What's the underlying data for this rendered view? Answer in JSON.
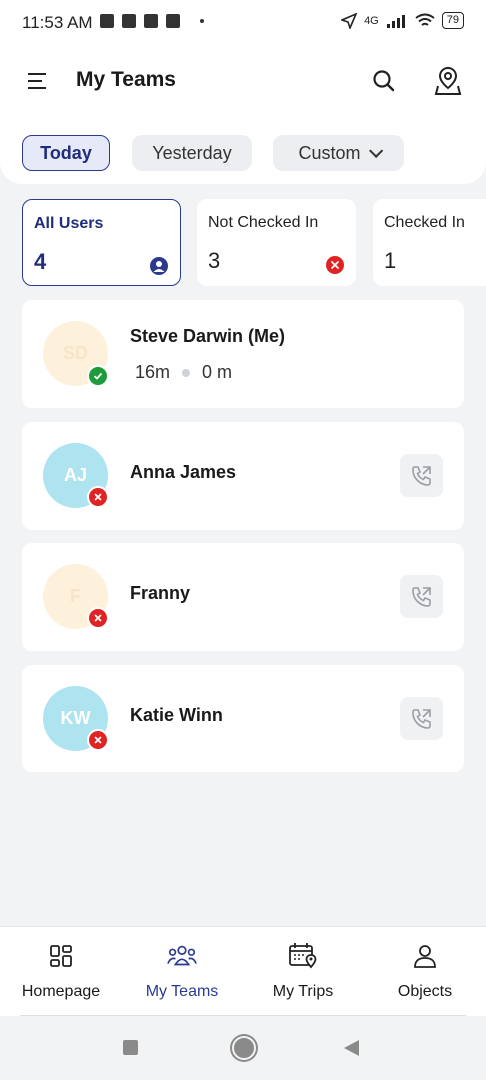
{
  "status_bar": {
    "time": "11:53 AM",
    "network": "4G",
    "battery": "79"
  },
  "header": {
    "title": "My Teams",
    "menu_icon": "hamburger-menu-icon",
    "search_icon": "search-icon",
    "map_icon": "map-pin-icon"
  },
  "filters": {
    "today": "Today",
    "yesterday": "Yesterday",
    "custom": "Custom",
    "selected": "Today"
  },
  "summary": [
    {
      "label": "All Users",
      "count": "4",
      "icon": "user-icon",
      "color": "#2b3a8f"
    },
    {
      "label": "Not Checked In",
      "count": "3",
      "icon": "close-icon",
      "color": "#e02424"
    },
    {
      "label": "Checked In",
      "count": "1"
    }
  ],
  "users": [
    {
      "initials": "SD",
      "name": "Steve Darwin (Me)",
      "avatar_color": "#fdf1dc",
      "status": "checked-in",
      "time": "16m",
      "distance": "0 m"
    },
    {
      "initials": "AJ",
      "name": "Anna James",
      "avatar_color": "#aee3f0",
      "status": "not-checked-in"
    },
    {
      "initials": "F",
      "name": "Franny",
      "avatar_color": "#fdf1dc",
      "status": "not-checked-in"
    },
    {
      "initials": "KW",
      "name": "Katie Winn",
      "avatar_color": "#aee3f0",
      "status": "not-checked-in"
    }
  ],
  "bottom_nav": [
    {
      "label": "Homepage",
      "icon": "grid-icon"
    },
    {
      "label": "My Teams",
      "icon": "team-icon",
      "active": true
    },
    {
      "label": "My Trips",
      "icon": "calendar-location-icon"
    },
    {
      "label": "Objects",
      "icon": "person-icon"
    }
  ],
  "colors": {
    "accent": "#2b3a8f",
    "checked": "#1e9b3a",
    "not_checked": "#e02424"
  }
}
